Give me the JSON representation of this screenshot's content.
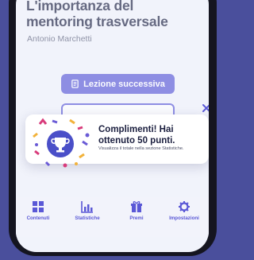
{
  "lesson": {
    "title": "L'importanza del mentoring trasversale",
    "author": "Antonio Marchetti",
    "next_label": "Lezione successiva"
  },
  "toast": {
    "title": "Complimenti! Hai ottenuto 50 punti.",
    "text": "Visualizza il totale nella sezione Statistiche."
  },
  "tabbar": {
    "items": [
      {
        "label": "Contenuti",
        "icon": "grid-icon"
      },
      {
        "label": "Statistiche",
        "icon": "bar-chart-icon"
      },
      {
        "label": "Premi",
        "icon": "gift-icon"
      },
      {
        "label": "Impostazioni",
        "icon": "gear-icon"
      }
    ]
  },
  "colors": {
    "accent": "#5a58d6",
    "background": "#4a4f9c",
    "text": "#1b1f3f"
  }
}
